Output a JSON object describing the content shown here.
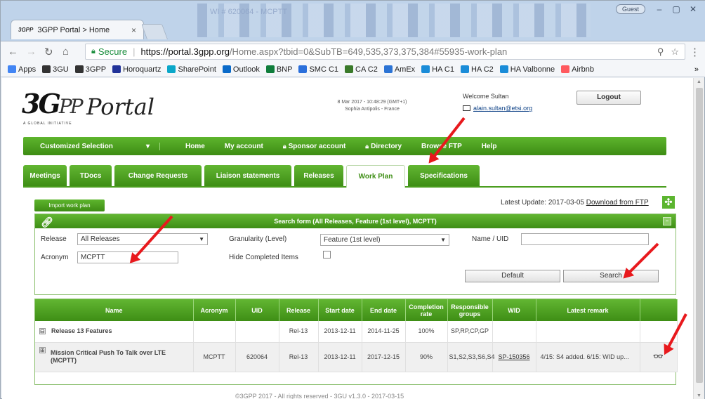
{
  "browser": {
    "ghost_title": "WI # 620064 - MCPTT",
    "tab": {
      "favicon": "3GPP",
      "title": "3GPP Portal > Home",
      "close": "×"
    },
    "guest": "Guest",
    "url": {
      "secure_label": "Secure",
      "separator": "|",
      "host": "https://portal.3gpp.org",
      "path": "/Home.aspx?tbid=0&SubTB=649,535,373,375,384#55935-work-plan"
    },
    "bookmarks": [
      {
        "label": "Apps",
        "icon": "apps-icon",
        "color": "#4285f4"
      },
      {
        "label": "3GU",
        "icon": "3gpp-icon",
        "color": "#333333"
      },
      {
        "label": "3GPP",
        "icon": "3gpp-icon",
        "color": "#333333"
      },
      {
        "label": "Horoquartz",
        "icon": "horoquartz-icon",
        "color": "#223399"
      },
      {
        "label": "SharePoint",
        "icon": "sharepoint-icon",
        "color": "#0aa7c9"
      },
      {
        "label": "Outlook",
        "icon": "outlook-icon",
        "color": "#0a6ac9"
      },
      {
        "label": "BNP",
        "icon": "bnp-icon",
        "color": "#0f7d3b"
      },
      {
        "label": "SMC C1",
        "icon": "smc-icon",
        "color": "#2a6fdb"
      },
      {
        "label": "CA C2",
        "icon": "ca-icon",
        "color": "#3a7a2a"
      },
      {
        "label": "AmEx",
        "icon": "amex-icon",
        "color": "#2b73d4"
      },
      {
        "label": "HA C1",
        "icon": "ha-icon",
        "color": "#1a8cd8"
      },
      {
        "label": "HA C2",
        "icon": "ha-icon",
        "color": "#1a8cd8"
      },
      {
        "label": "HA Valbonne",
        "icon": "ha-icon",
        "color": "#1a8cd8"
      },
      {
        "label": "Airbnb",
        "icon": "airbnb-icon",
        "color": "#ff5a5f"
      }
    ],
    "more_bookmarks": "»"
  },
  "header": {
    "logo": "3G",
    "logo_tail": "PP",
    "tagline": "A GLOBAL INITIATIVE",
    "portal": "Portal",
    "datetime_line1": "8 Mar 2017 - 10:48:29 (GMT+1)",
    "datetime_line2": "Sophia Antipolis - France",
    "welcome": "Welcome Sultan",
    "email": "alain.sultan@etsi.org",
    "logout": "Logout"
  },
  "navbar": {
    "customized": "Customized Selection",
    "items": [
      "Home",
      "My account",
      "Sponsor account",
      "Directory",
      "Browse FTP",
      "Help"
    ]
  },
  "tabs": [
    "Meetings",
    "TDocs",
    "Change Requests",
    "Liaison statements",
    "Releases",
    "Work Plan",
    "Specifications"
  ],
  "active_tab": "Work Plan",
  "workplan": {
    "import_button": "Import work plan",
    "latest_update": "Latest Update: 2017-03-05",
    "download": "Download from FTP"
  },
  "search": {
    "title": "Search form (All Releases, Feature (1st level), MCPTT)",
    "release_label": "Release",
    "release_value": "All Releases",
    "acronym_label": "Acronym",
    "acronym_value": "MCPTT",
    "granularity_label": "Granularity (Level)",
    "granularity_value": "Feature (1st level)",
    "hide_label": "Hide Completed Items",
    "hide_checked": false,
    "name_label": "Name / UID",
    "name_value": "",
    "default_button": "Default",
    "search_button": "Search"
  },
  "results": {
    "columns": [
      "Name",
      "Acronym",
      "UID",
      "Release",
      "Start date",
      "End date",
      "Completion rate",
      "Responsible groups",
      "WID",
      "Latest remark",
      ""
    ],
    "release_row": {
      "expander": "⊟",
      "name": "Release 13 Features",
      "acronym": "",
      "uid": "",
      "release": "Rel-13",
      "start": "2013-12-11",
      "end": "2014-11-25",
      "completion": "100%",
      "groups": "SP,RP,CP,GP",
      "wid": "",
      "remark": ""
    },
    "feature_row": {
      "expander": "⊞",
      "name": "Mission Critical Push To Talk over LTE (MCPTT)",
      "acronym": "MCPTT",
      "uid": "620064",
      "release": "Rel-13",
      "start": "2013-12-11",
      "end": "2017-12-15",
      "completion": "90%",
      "groups": "S1,S2,S3,S6,S4",
      "wid": "SP-150356",
      "remark": "4/15: S4 added. 6/15: WID up...",
      "action_icon": "glasses-icon"
    }
  },
  "footer": "©3GPP 2017 - All rights reserved - 3GU v1.3.0 - 2017-03-15",
  "colors": {
    "green": "#4a9d1f",
    "red_text": "#e0161f",
    "blue_link": "#1b2fb0",
    "arrow": "#e8191d"
  }
}
